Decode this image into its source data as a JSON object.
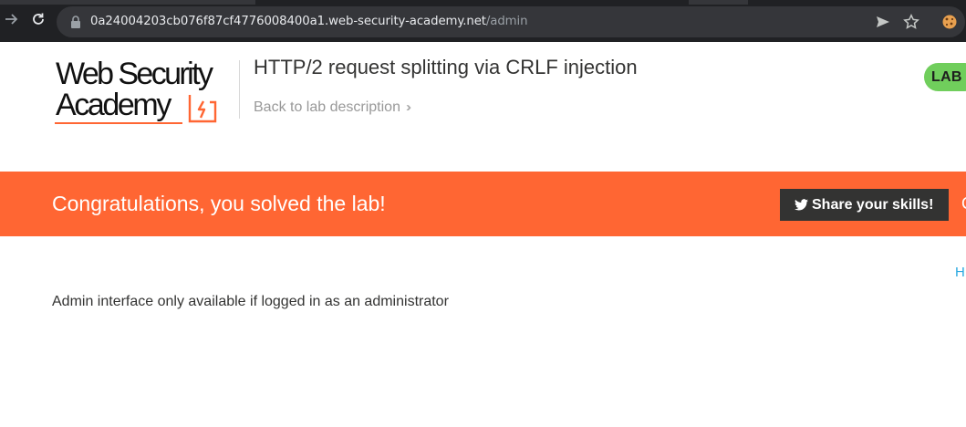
{
  "browser": {
    "url_host": "0a24004203cb076f87cf4776008400a1.web-security-academy.net",
    "url_path": "/admin"
  },
  "header": {
    "logo_line1": "Web Security",
    "logo_line2": "Academy",
    "lab_title": "HTTP/2 request splitting via CRLF injection",
    "back_link": "Back to lab description",
    "badge": "LAB"
  },
  "banner": {
    "message": "Congratulations, you solved the lab!",
    "share_label": "Share your skills!",
    "edge_glyph": "C"
  },
  "content": {
    "home_link": "H",
    "admin_message": "Admin interface only available if logged in as an administrator"
  },
  "colors": {
    "banner": "#ff6633",
    "badge": "#70ce5c",
    "share_button": "#333332",
    "link": "#29a8e0"
  }
}
